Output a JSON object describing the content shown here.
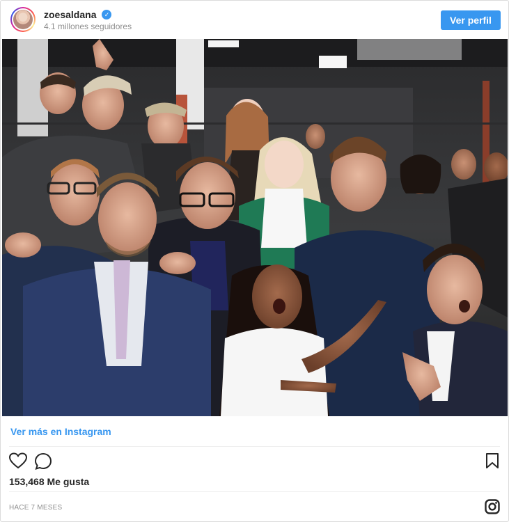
{
  "header": {
    "username": "zoesaldana",
    "followers": "4.1 millones seguidores",
    "profile_button": "Ver perfil",
    "verified_icon": "verified-check-icon"
  },
  "post": {
    "see_more": "Ver más en Instagram",
    "likes": "153,468 Me gusta",
    "timestamp": "HACE 7 MESES"
  },
  "icons": {
    "like": "heart-outline-icon",
    "comment": "comment-bubble-icon",
    "save": "bookmark-outline-icon",
    "brand": "instagram-glyph-icon"
  },
  "colors": {
    "accent": "#3897f0",
    "text": "#262626",
    "muted": "#8e8e8e",
    "border": "#dbdbdb"
  }
}
